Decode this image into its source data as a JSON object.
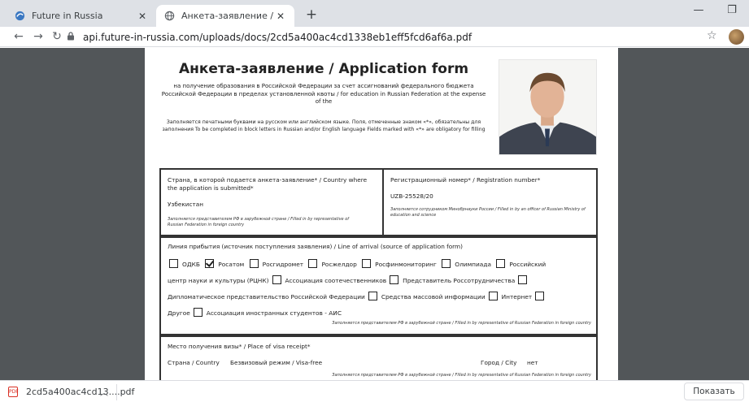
{
  "browser": {
    "tabs": [
      {
        "title": "Future in Russia",
        "active": false
      },
      {
        "title": "Анкета-заявление / Application",
        "active": true
      }
    ],
    "new_tab": "+",
    "url": "api.future-in-russia.com/uploads/docs/2cd5a400ac4cd1338eb1eff5fcd6af6a.pdf",
    "icons": {
      "back": "back-arrow-icon",
      "forward": "forward-arrow-icon",
      "reload": "reload-icon",
      "lock": "lock-icon",
      "star": "bookmark-star-icon"
    },
    "window": {
      "minimize": "—",
      "maximize": "❐"
    }
  },
  "pdf": {
    "title": "Анкета-заявление / Application form",
    "subtitle": "на получение образования в Российской Федерации за счет ассигнований федерального бюджета Российской Федерации в пределах установленной квоты / for education in Russian Federation at the expense of the",
    "note": "Заполняется печатными буквами на русском или английском языке. Поля, отмеченные знаком «*», обязательны для заполнения To be completed in block letters in Russian and/or English language Fields marked with «*» are obligatory for filling",
    "section1": {
      "country_label": "Страна, в которой подается анкета-заявление* / Country where the application is submitted*",
      "country_value": "Узбекистан",
      "country_hint": "Заполняется представителем РФ в зарубежной стране / Filled in by representative of Russian Federation in foreign country",
      "reg_label": "Регистрационный номер* / Registration number*",
      "reg_value": "UZB-25528/20",
      "reg_hint": "Заполняется сотрудником Минобрнауки России / Filled in by an officer of Russian Ministry of education and science"
    },
    "section2": {
      "label": "Линия прибытия (источник поступления заявления) / Line of arrival (source of application form)",
      "options_rows": [
        [
          {
            "text": "ОДКБ",
            "checked": false
          },
          {
            "text": "Росатом",
            "checked": true
          },
          {
            "text": "Росгидромет",
            "checked": false
          },
          {
            "text": "Росжелдор",
            "checked": false
          },
          {
            "text": "Росфинмониторинг",
            "checked": false
          },
          {
            "text": "Олимпиада",
            "checked": false
          },
          {
            "text": "Российский",
            "checked": false
          }
        ],
        [
          {
            "text": "центр науки и культуры (РЦНК)",
            "checked": false,
            "box_after": true
          },
          {
            "text": "Ассоциация соотечественников",
            "checked": false,
            "box_after": true
          },
          {
            "text": "Представитель Россотрудничества",
            "checked": false,
            "box_after": true
          }
        ],
        [
          {
            "text": "Дипломатическое представительство Российской Федерации",
            "checked": false,
            "box_after": true
          },
          {
            "text": "Средства массовой информации",
            "checked": false,
            "box_after": true
          },
          {
            "text": "Интернет",
            "checked": false,
            "box_after": true
          }
        ],
        [
          {
            "text": "Другое",
            "checked": false,
            "box_after": true
          },
          {
            "text": "Ассоциация иностранных студентов - АИС",
            "checked": false,
            "box_after": false
          }
        ]
      ],
      "hint": "Заполняется представителем РФ в зарубежной стране / Filled in by representative of Russian Federation in foreign country"
    },
    "section3": {
      "label": "Место получения визы* / Place of visa receipt*",
      "country_label": "Страна / Country",
      "country_value": "Безвизовый режим / Visa-free",
      "city_label": "Город / City",
      "city_value": "нет",
      "hint": "Заполняется представителем РФ в зарубежной стране / Filled in by representative of Russian Federation in foreign country"
    }
  },
  "downloads": {
    "file_name": "2cd5a400ac4cd13....pdf",
    "file_type": "PDF",
    "show_all": "Показать все"
  }
}
